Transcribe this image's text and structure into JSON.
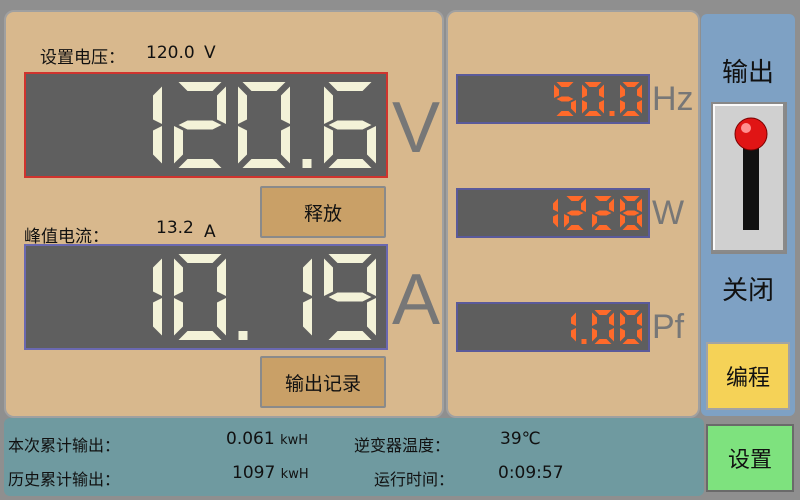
{
  "left_panel": {
    "set_voltage_label": "设置电压：",
    "set_voltage_value": "120.0",
    "set_voltage_unit": "V",
    "voltage_display": "120.6",
    "voltage_unit": "V",
    "release_button": "释放",
    "peak_current_label": "峰值电流：",
    "peak_current_value": "13.2",
    "peak_current_unit": "A",
    "current_display": "10.19",
    "current_unit": "A",
    "output_record_button": "输出记录"
  },
  "middle_panel": {
    "frequency": "50.0",
    "frequency_unit": "Hz",
    "power": "1228",
    "power_unit": "W",
    "power_factor": "1.00",
    "power_factor_unit": "Pf"
  },
  "sidebar": {
    "output_label": "输出",
    "close_label": "关闭",
    "program_button": "编程",
    "settings_button": "设置"
  },
  "status_bar": {
    "session_output_label": "本次累计输出：",
    "session_output_value": "0.061",
    "session_output_unit": "kwH",
    "history_output_label": "历史累计输出：",
    "history_output_value": "1097",
    "history_output_unit": "kwH",
    "inverter_temp_label": "逆变器温度：",
    "inverter_temp_value": "39",
    "inverter_temp_unit": "℃",
    "runtime_label": "运行时间：",
    "runtime_value": "0:09:57"
  },
  "colors": {
    "panel_bg": "#d8b88d",
    "big_digit": "#f3f2d8",
    "small_digit": "#ff6a2a",
    "sidebar_bg": "#7ea1c4",
    "status_bg": "#6f9aa0",
    "program_button": "#f5d257",
    "settings_button": "#7ee27e",
    "toggle_knob": "#e01515"
  },
  "icons": {
    "toggle": "lever-switch-icon"
  }
}
